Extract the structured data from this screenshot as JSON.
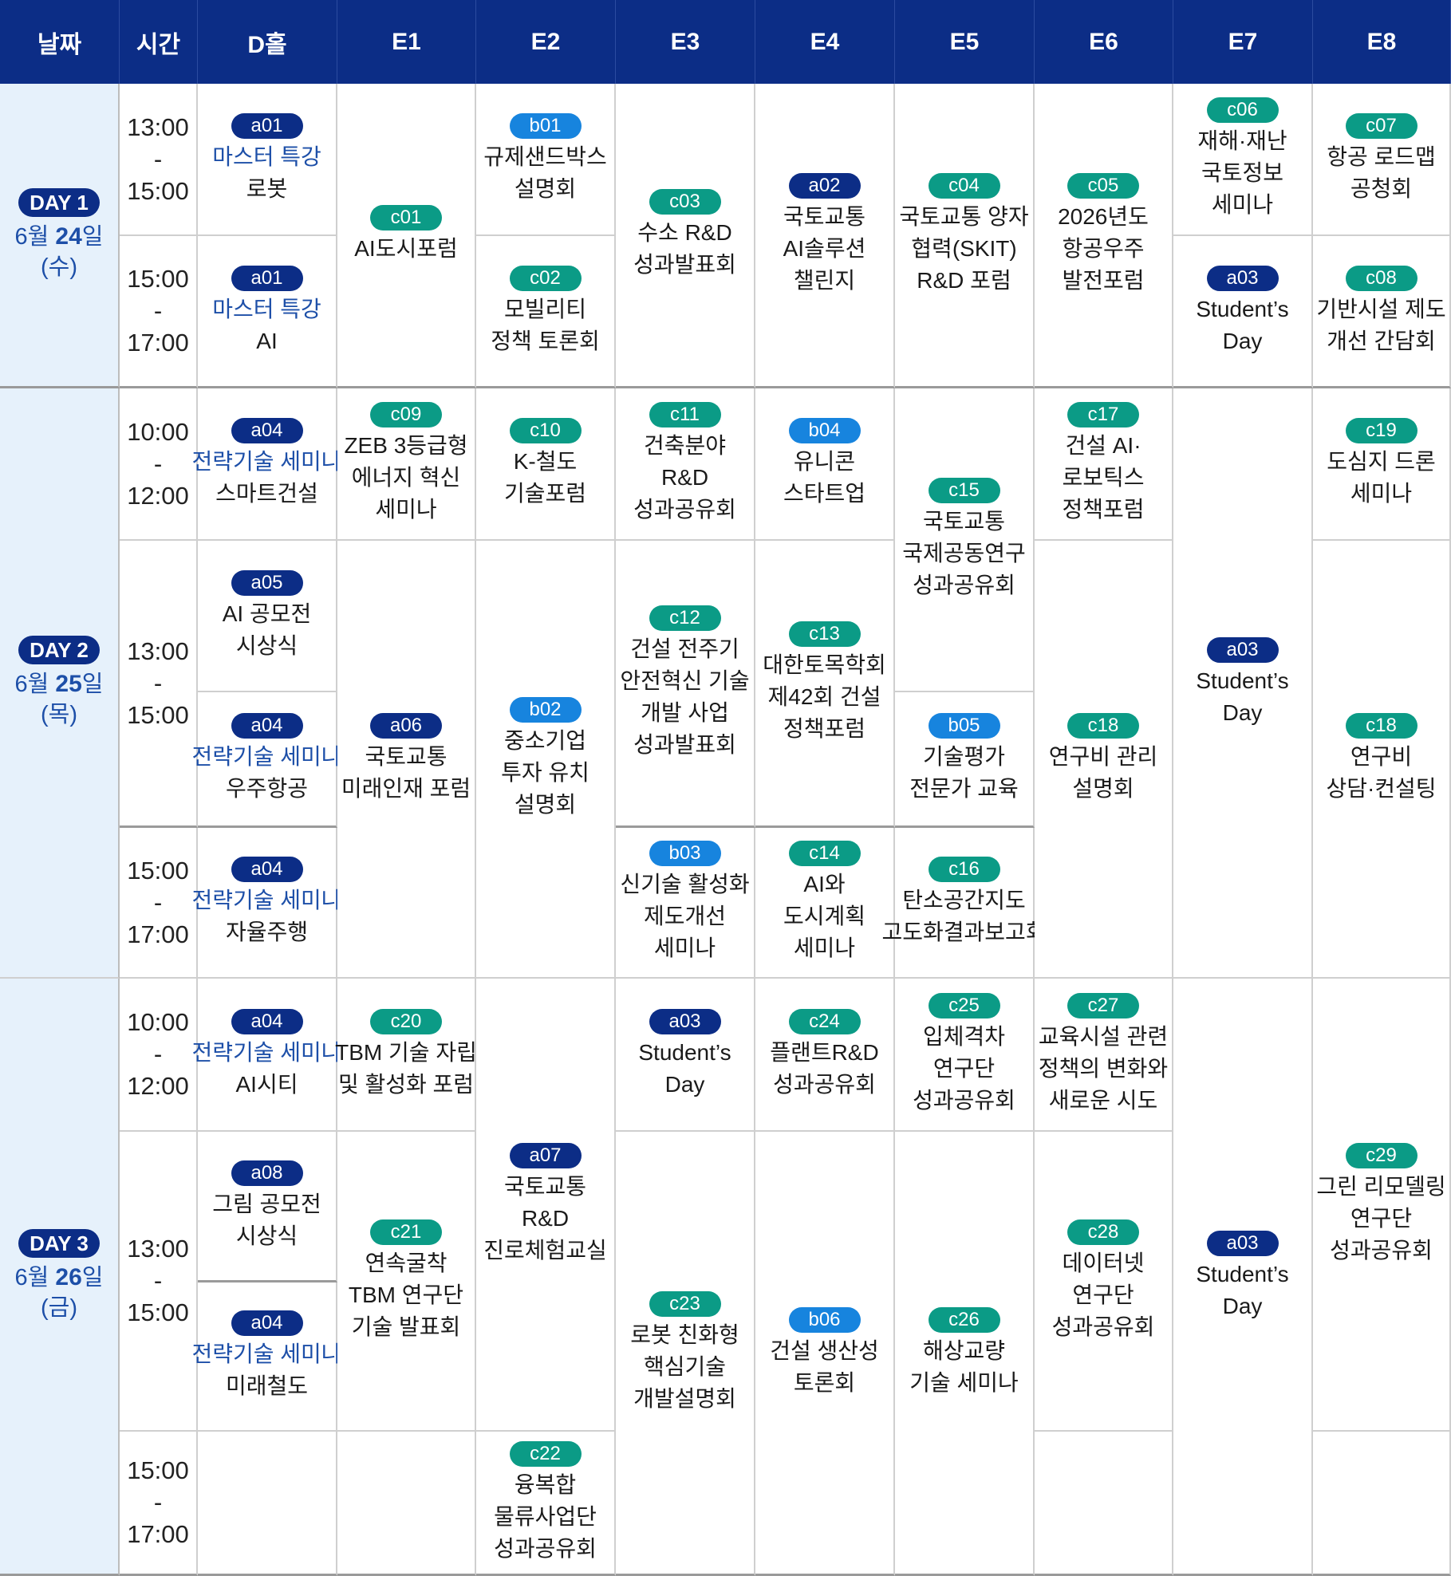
{
  "header": [
    "날짜",
    "시간",
    "D홀",
    "E1",
    "E2",
    "E3",
    "E4",
    "E5",
    "E6",
    "E7",
    "E8"
  ],
  "days": [
    {
      "badge": "DAY 1",
      "month": "6월 ",
      "num": "24",
      "suffix": "일",
      "weekday": "(수)"
    },
    {
      "badge": "DAY 2",
      "month": "6월 ",
      "num": "25",
      "suffix": "일",
      "weekday": "(목)"
    },
    {
      "badge": "DAY 3",
      "month": "6월 ",
      "num": "26",
      "suffix": "일",
      "weekday": "(금)"
    }
  ],
  "times": [
    [
      "13:00",
      "-",
      "15:00"
    ],
    [
      "15:00",
      "-",
      "17:00"
    ],
    [
      "10:00",
      "-",
      "12:00"
    ],
    [
      "13:00",
      "-",
      "15:00"
    ],
    [
      "15:00",
      "-",
      "17:00"
    ],
    [
      "10:00",
      "-",
      "12:00"
    ],
    [
      "13:00",
      "-",
      "15:00"
    ],
    [
      "15:00",
      "-",
      "17:00"
    ]
  ],
  "sessions": [
    {
      "code": "a01",
      "lines": [
        "마스터 특강",
        "로봇"
      ]
    },
    {
      "code": "a01",
      "lines": [
        "마스터 특강",
        "AI"
      ]
    },
    {
      "code": "c01",
      "lines": [
        "AI도시포럼"
      ]
    },
    {
      "code": "b01",
      "lines": [
        "규제샌드박스",
        "설명회"
      ]
    },
    {
      "code": "c02",
      "lines": [
        "모빌리티",
        "정책 토론회"
      ]
    },
    {
      "code": "c03",
      "lines": [
        "수소 R&D",
        "성과발표회"
      ]
    },
    {
      "code": "a02",
      "lines": [
        "국토교통",
        "AI솔루션",
        "챌린지"
      ]
    },
    {
      "code": "c04",
      "lines": [
        "국토교통 양자",
        "협력(SKIT)",
        "R&D 포럼"
      ]
    },
    {
      "code": "c05",
      "lines": [
        "2026년도",
        "항공우주",
        "발전포럼"
      ]
    },
    {
      "code": "c06",
      "lines": [
        "재해·재난",
        "국토정보",
        "세미나"
      ]
    },
    {
      "code": "a03",
      "lines": [
        "Student’s",
        "Day"
      ]
    },
    {
      "code": "c07",
      "lines": [
        "항공 로드맵",
        "공청회"
      ]
    },
    {
      "code": "c08",
      "lines": [
        "기반시설 제도",
        "개선 간담회"
      ]
    },
    {
      "code": "a04",
      "lines": [
        "전략기술 세미나",
        "스마트건설"
      ]
    },
    {
      "code": "a05",
      "lines": [
        "AI 공모전",
        "시상식"
      ]
    },
    {
      "code": "a04",
      "lines": [
        "전략기술 세미나",
        "우주항공"
      ]
    },
    {
      "code": "a04",
      "lines": [
        "전략기술 세미나",
        "자율주행"
      ]
    },
    {
      "code": "c09",
      "lines": [
        "ZEB 3등급형",
        "에너지 혁신",
        "세미나"
      ]
    },
    {
      "code": "a06",
      "lines": [
        "국토교통",
        "미래인재 포럼"
      ]
    },
    {
      "code": "c10",
      "lines": [
        "K-철도",
        "기술포럼"
      ]
    },
    {
      "code": "b02",
      "lines": [
        "중소기업",
        "투자 유치",
        "설명회"
      ]
    },
    {
      "code": "c11",
      "lines": [
        "건축분야",
        "R&D",
        "성과공유회"
      ]
    },
    {
      "code": "c12",
      "lines": [
        "건설 전주기",
        "안전혁신 기술",
        "개발 사업",
        "성과발표회"
      ]
    },
    {
      "code": "b03",
      "lines": [
        "신기술 활성화",
        "제도개선",
        "세미나"
      ]
    },
    {
      "code": "b04",
      "lines": [
        "유니콘",
        "스타트업"
      ]
    },
    {
      "code": "c13",
      "lines": [
        "대한토목학회",
        "제42회 건설",
        "정책포럼"
      ]
    },
    {
      "code": "c14",
      "lines": [
        "AI와",
        "도시계획",
        "세미나"
      ]
    },
    {
      "code": "c15",
      "lines": [
        "국토교통",
        "국제공동연구",
        "성과공유회"
      ]
    },
    {
      "code": "b05",
      "lines": [
        "기술평가",
        "전문가 교육"
      ]
    },
    {
      "code": "c16",
      "lines": [
        "탄소공간지도",
        "고도화결과보고회"
      ]
    },
    {
      "code": "c17",
      "lines": [
        "건설 AI·",
        "로보틱스",
        "정책포럼"
      ]
    },
    {
      "code": "c18",
      "lines": [
        "연구비 관리",
        "설명회"
      ]
    },
    {
      "code": "a03",
      "lines": [
        "Student’s",
        "Day"
      ]
    },
    {
      "code": "c19",
      "lines": [
        "도심지 드론",
        "세미나"
      ]
    },
    {
      "code": "c18",
      "lines": [
        "연구비",
        "상담·컨설팅"
      ]
    },
    {
      "code": "a04",
      "lines": [
        "전략기술 세미나",
        "AI시티"
      ]
    },
    {
      "code": "a08",
      "lines": [
        "그림 공모전",
        "시상식"
      ]
    },
    {
      "code": "a04",
      "lines": [
        "전략기술 세미나",
        "미래철도"
      ]
    },
    {
      "code": "c20",
      "lines": [
        "TBM 기술 자립",
        "및 활성화 포럼"
      ]
    },
    {
      "code": "c21",
      "lines": [
        "연속굴착",
        "TBM 연구단",
        "기술 발표회"
      ]
    },
    {
      "code": "a07",
      "lines": [
        "국토교통",
        "R&D",
        "진로체험교실"
      ]
    },
    {
      "code": "c22",
      "lines": [
        "융복합",
        "물류사업단",
        "성과공유회"
      ]
    },
    {
      "code": "a03",
      "lines": [
        "Student’s",
        "Day"
      ]
    },
    {
      "code": "c23",
      "lines": [
        "로봇 친화형",
        "핵심기술",
        "개발설명회"
      ]
    },
    {
      "code": "c24",
      "lines": [
        "플랜트R&D",
        "성과공유회"
      ]
    },
    {
      "code": "b06",
      "lines": [
        "건설 생산성",
        "토론회"
      ]
    },
    {
      "code": "c25",
      "lines": [
        "입체격차",
        "연구단",
        "성과공유회"
      ]
    },
    {
      "code": "c26",
      "lines": [
        "해상교량",
        "기술 세미나"
      ]
    },
    {
      "code": "c27",
      "lines": [
        "교육시설 관련",
        "정책의 변화와",
        "새로운 시도"
      ]
    },
    {
      "code": "c28",
      "lines": [
        "데이터넷",
        "연구단",
        "성과공유회"
      ]
    },
    {
      "code": "a03",
      "lines": [
        "Student’s",
        "Day"
      ]
    },
    {
      "code": "c29",
      "lines": [
        "그린 리모델링",
        "연구단",
        "성과공유회"
      ]
    }
  ],
  "colors": {
    "header_bg": "#0c2d86",
    "date_bg": "#e6f1fb",
    "badge_a": "#0c2d86",
    "badge_b": "#1784de",
    "badge_c": "#0b9b86",
    "highlight_text": "#1d4fa8"
  }
}
